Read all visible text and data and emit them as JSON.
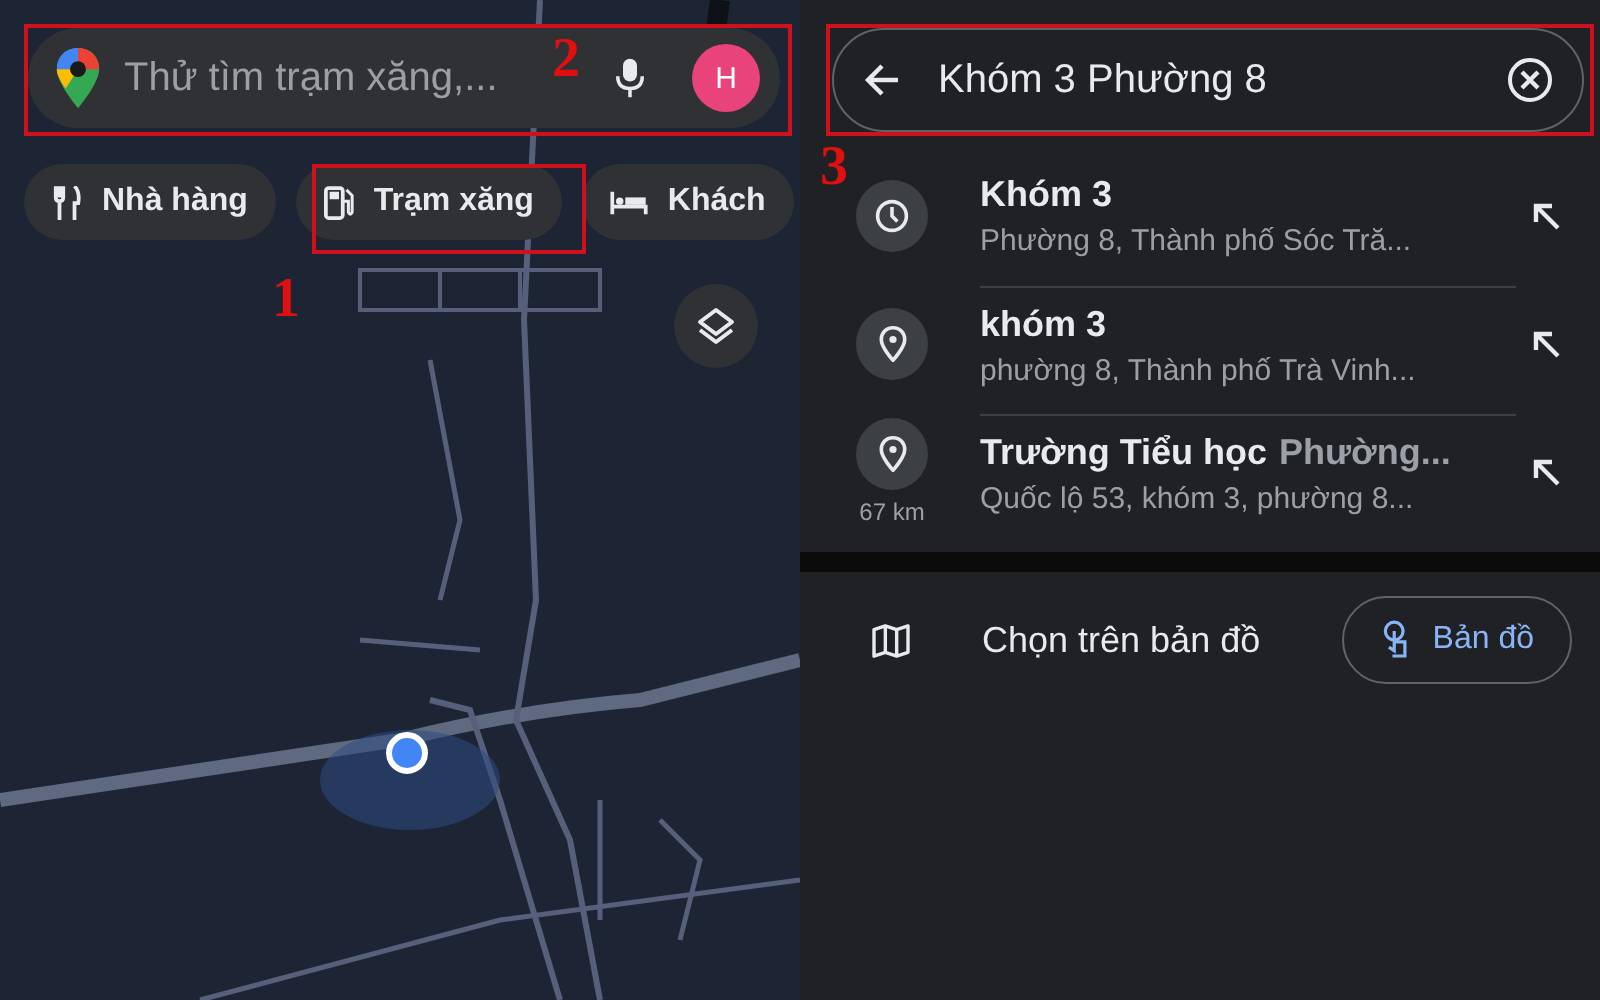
{
  "map_view": {
    "search": {
      "placeholder": "Thử tìm trạm xăng,..."
    },
    "avatar": "H",
    "chips": [
      {
        "kind": "restaurant",
        "label": "Nhà hàng"
      },
      {
        "kind": "gas",
        "label": "Trạm xăng"
      },
      {
        "kind": "hotel",
        "label": "Khách"
      }
    ]
  },
  "search_panel": {
    "query": "Khóm 3 Phường 8",
    "results": [
      {
        "kind": "recent",
        "title": "Khóm 3",
        "subtitle": "Phường 8, Thành phố Sóc Tră..."
      },
      {
        "kind": "place",
        "title": "khóm 3",
        "subtitle": "phường 8, Thành phố Trà Vinh..."
      },
      {
        "kind": "place",
        "title": "Trường Tiểu học",
        "title_extra": "Phường...",
        "distance": "67 km",
        "subtitle": "Quốc lộ 53, khóm 3, phường 8..."
      }
    ],
    "choose_on_map": {
      "label": "Chọn trên bản đồ",
      "button": "Bản đồ"
    }
  },
  "annotations": [
    {
      "label": "1"
    },
    {
      "label": "2"
    },
    {
      "label": "3"
    }
  ]
}
